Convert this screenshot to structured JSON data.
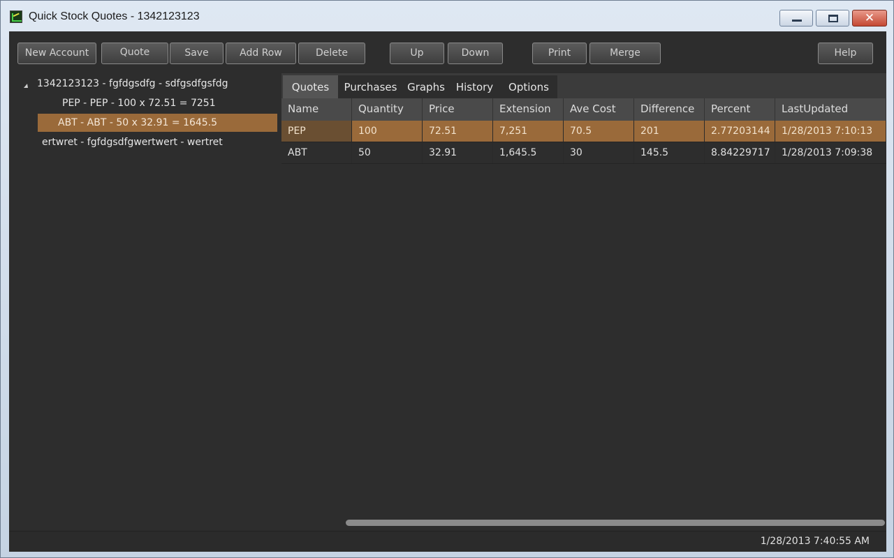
{
  "window": {
    "title": "Quick Stock Quotes - 1342123123",
    "close_glyph": "✕"
  },
  "toolbar": {
    "new_account": "New Account",
    "quote": "Quote",
    "save": "Save",
    "add_row": "Add Row",
    "delete": "Delete",
    "up": "Up",
    "down": "Down",
    "print": "Print",
    "merge": "Merge",
    "help": "Help"
  },
  "tree": {
    "items": [
      "1342123123 - fgfdgsdfg - sdfgsdfgsfdg",
      "PEP - PEP - 100 x 72.51 = 7251",
      "ABT - ABT - 50 x 32.91 = 1645.5",
      "ertwret - fgfdgsdfgwertwert - wertret"
    ]
  },
  "tabs": [
    "Quotes",
    "Purchases",
    "Graphs",
    "History",
    "Options"
  ],
  "grid": {
    "headers": [
      "Name",
      "Quantity",
      "Price",
      "Extension",
      "Ave Cost",
      "Difference",
      "Percent",
      "LastUpdated"
    ],
    "rows": [
      [
        "PEP",
        "100",
        "72.51",
        "7,251",
        "70.5",
        "201",
        "2.77203144",
        "1/28/2013 7:10:13"
      ],
      [
        "ABT",
        "50",
        "32.91",
        "1,645.5",
        "30",
        "145.5",
        "8.84229717",
        "1/28/2013 7:09:38"
      ]
    ]
  },
  "status": {
    "datetime": "1/28/2013 7:40:55 AM"
  },
  "colors": {
    "selection": "#9a6a3a",
    "background": "#2d2d2d"
  }
}
